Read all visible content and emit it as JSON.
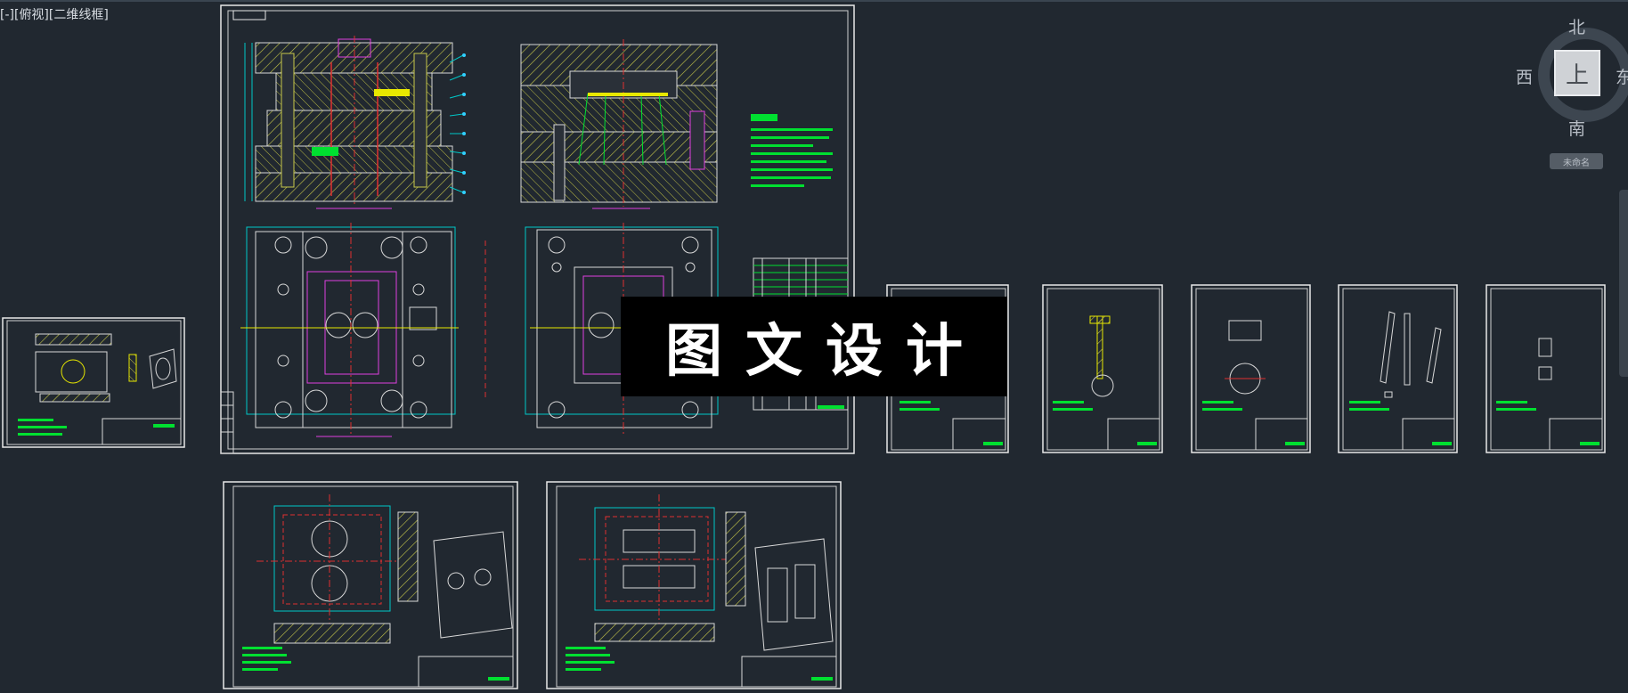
{
  "view_label": "[-][俯视][二维线框]",
  "watermark": "图文设计",
  "viewcube": {
    "north": "北",
    "south": "南",
    "west": "西",
    "east": "东",
    "face": "上",
    "ucs": "未命名"
  },
  "colors": {
    "background": "#212830",
    "sheet_border": "#e8e8e8",
    "hatch": "#c8c84a",
    "outline": "#d8d8d8",
    "center_line": "#e03030",
    "dimension": "#00c8c8",
    "annotation": "#00e030",
    "callout": "#e040e0",
    "cyan_text": "#30d0ff",
    "yellow": "#e8e800",
    "watermark_bg": "#000000",
    "watermark_text": "#ffffff"
  }
}
